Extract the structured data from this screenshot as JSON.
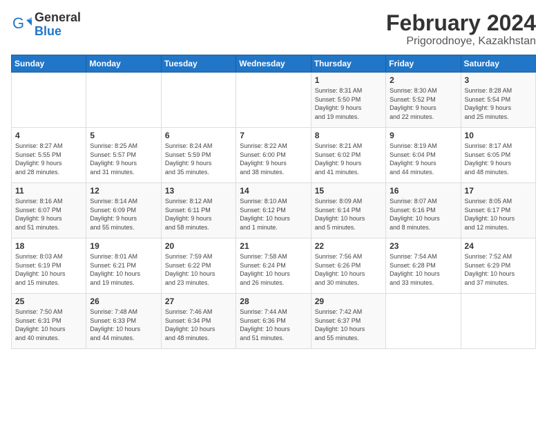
{
  "logo": {
    "general": "General",
    "blue": "Blue"
  },
  "title": "February 2024",
  "subtitle": "Prigorodnoye, Kazakhstan",
  "weekdays": [
    "Sunday",
    "Monday",
    "Tuesday",
    "Wednesday",
    "Thursday",
    "Friday",
    "Saturday"
  ],
  "weeks": [
    [
      {
        "day": "",
        "info": ""
      },
      {
        "day": "",
        "info": ""
      },
      {
        "day": "",
        "info": ""
      },
      {
        "day": "",
        "info": ""
      },
      {
        "day": "1",
        "info": "Sunrise: 8:31 AM\nSunset: 5:50 PM\nDaylight: 9 hours\nand 19 minutes."
      },
      {
        "day": "2",
        "info": "Sunrise: 8:30 AM\nSunset: 5:52 PM\nDaylight: 9 hours\nand 22 minutes."
      },
      {
        "day": "3",
        "info": "Sunrise: 8:28 AM\nSunset: 5:54 PM\nDaylight: 9 hours\nand 25 minutes."
      }
    ],
    [
      {
        "day": "4",
        "info": "Sunrise: 8:27 AM\nSunset: 5:55 PM\nDaylight: 9 hours\nand 28 minutes."
      },
      {
        "day": "5",
        "info": "Sunrise: 8:25 AM\nSunset: 5:57 PM\nDaylight: 9 hours\nand 31 minutes."
      },
      {
        "day": "6",
        "info": "Sunrise: 8:24 AM\nSunset: 5:59 PM\nDaylight: 9 hours\nand 35 minutes."
      },
      {
        "day": "7",
        "info": "Sunrise: 8:22 AM\nSunset: 6:00 PM\nDaylight: 9 hours\nand 38 minutes."
      },
      {
        "day": "8",
        "info": "Sunrise: 8:21 AM\nSunset: 6:02 PM\nDaylight: 9 hours\nand 41 minutes."
      },
      {
        "day": "9",
        "info": "Sunrise: 8:19 AM\nSunset: 6:04 PM\nDaylight: 9 hours\nand 44 minutes."
      },
      {
        "day": "10",
        "info": "Sunrise: 8:17 AM\nSunset: 6:05 PM\nDaylight: 9 hours\nand 48 minutes."
      }
    ],
    [
      {
        "day": "11",
        "info": "Sunrise: 8:16 AM\nSunset: 6:07 PM\nDaylight: 9 hours\nand 51 minutes."
      },
      {
        "day": "12",
        "info": "Sunrise: 8:14 AM\nSunset: 6:09 PM\nDaylight: 9 hours\nand 55 minutes."
      },
      {
        "day": "13",
        "info": "Sunrise: 8:12 AM\nSunset: 6:11 PM\nDaylight: 9 hours\nand 58 minutes."
      },
      {
        "day": "14",
        "info": "Sunrise: 8:10 AM\nSunset: 6:12 PM\nDaylight: 10 hours\nand 1 minute."
      },
      {
        "day": "15",
        "info": "Sunrise: 8:09 AM\nSunset: 6:14 PM\nDaylight: 10 hours\nand 5 minutes."
      },
      {
        "day": "16",
        "info": "Sunrise: 8:07 AM\nSunset: 6:16 PM\nDaylight: 10 hours\nand 8 minutes."
      },
      {
        "day": "17",
        "info": "Sunrise: 8:05 AM\nSunset: 6:17 PM\nDaylight: 10 hours\nand 12 minutes."
      }
    ],
    [
      {
        "day": "18",
        "info": "Sunrise: 8:03 AM\nSunset: 6:19 PM\nDaylight: 10 hours\nand 15 minutes."
      },
      {
        "day": "19",
        "info": "Sunrise: 8:01 AM\nSunset: 6:21 PM\nDaylight: 10 hours\nand 19 minutes."
      },
      {
        "day": "20",
        "info": "Sunrise: 7:59 AM\nSunset: 6:22 PM\nDaylight: 10 hours\nand 23 minutes."
      },
      {
        "day": "21",
        "info": "Sunrise: 7:58 AM\nSunset: 6:24 PM\nDaylight: 10 hours\nand 26 minutes."
      },
      {
        "day": "22",
        "info": "Sunrise: 7:56 AM\nSunset: 6:26 PM\nDaylight: 10 hours\nand 30 minutes."
      },
      {
        "day": "23",
        "info": "Sunrise: 7:54 AM\nSunset: 6:28 PM\nDaylight: 10 hours\nand 33 minutes."
      },
      {
        "day": "24",
        "info": "Sunrise: 7:52 AM\nSunset: 6:29 PM\nDaylight: 10 hours\nand 37 minutes."
      }
    ],
    [
      {
        "day": "25",
        "info": "Sunrise: 7:50 AM\nSunset: 6:31 PM\nDaylight: 10 hours\nand 40 minutes."
      },
      {
        "day": "26",
        "info": "Sunrise: 7:48 AM\nSunset: 6:33 PM\nDaylight: 10 hours\nand 44 minutes."
      },
      {
        "day": "27",
        "info": "Sunrise: 7:46 AM\nSunset: 6:34 PM\nDaylight: 10 hours\nand 48 minutes."
      },
      {
        "day": "28",
        "info": "Sunrise: 7:44 AM\nSunset: 6:36 PM\nDaylight: 10 hours\nand 51 minutes."
      },
      {
        "day": "29",
        "info": "Sunrise: 7:42 AM\nSunset: 6:37 PM\nDaylight: 10 hours\nand 55 minutes."
      },
      {
        "day": "",
        "info": ""
      },
      {
        "day": "",
        "info": ""
      }
    ]
  ]
}
